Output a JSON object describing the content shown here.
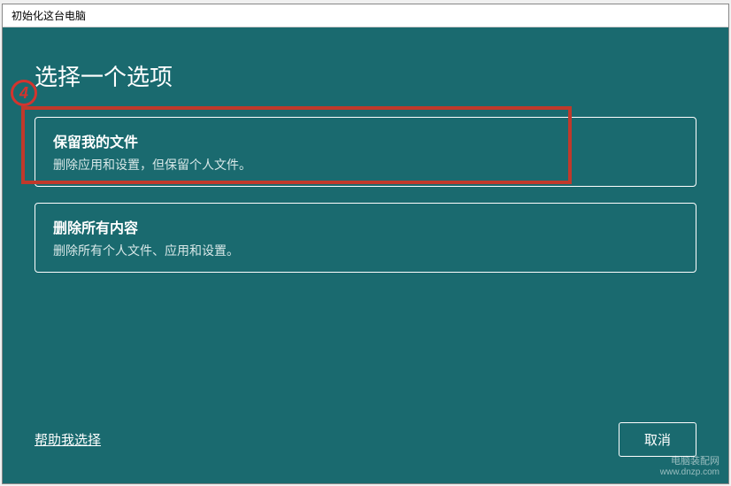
{
  "window": {
    "title": "初始化这台电脑"
  },
  "heading": "选择一个选项",
  "options": [
    {
      "title": "保留我的文件",
      "desc": "删除应用和设置，但保留个人文件。"
    },
    {
      "title": "删除所有内容",
      "desc": "删除所有个人文件、应用和设置。"
    }
  ],
  "footer": {
    "help_link": "帮助我选择",
    "cancel_label": "取消"
  },
  "annotation": {
    "marker_number": "4"
  },
  "watermark": {
    "line1": "电脑装配网",
    "line2": "www.dnzp.com"
  }
}
